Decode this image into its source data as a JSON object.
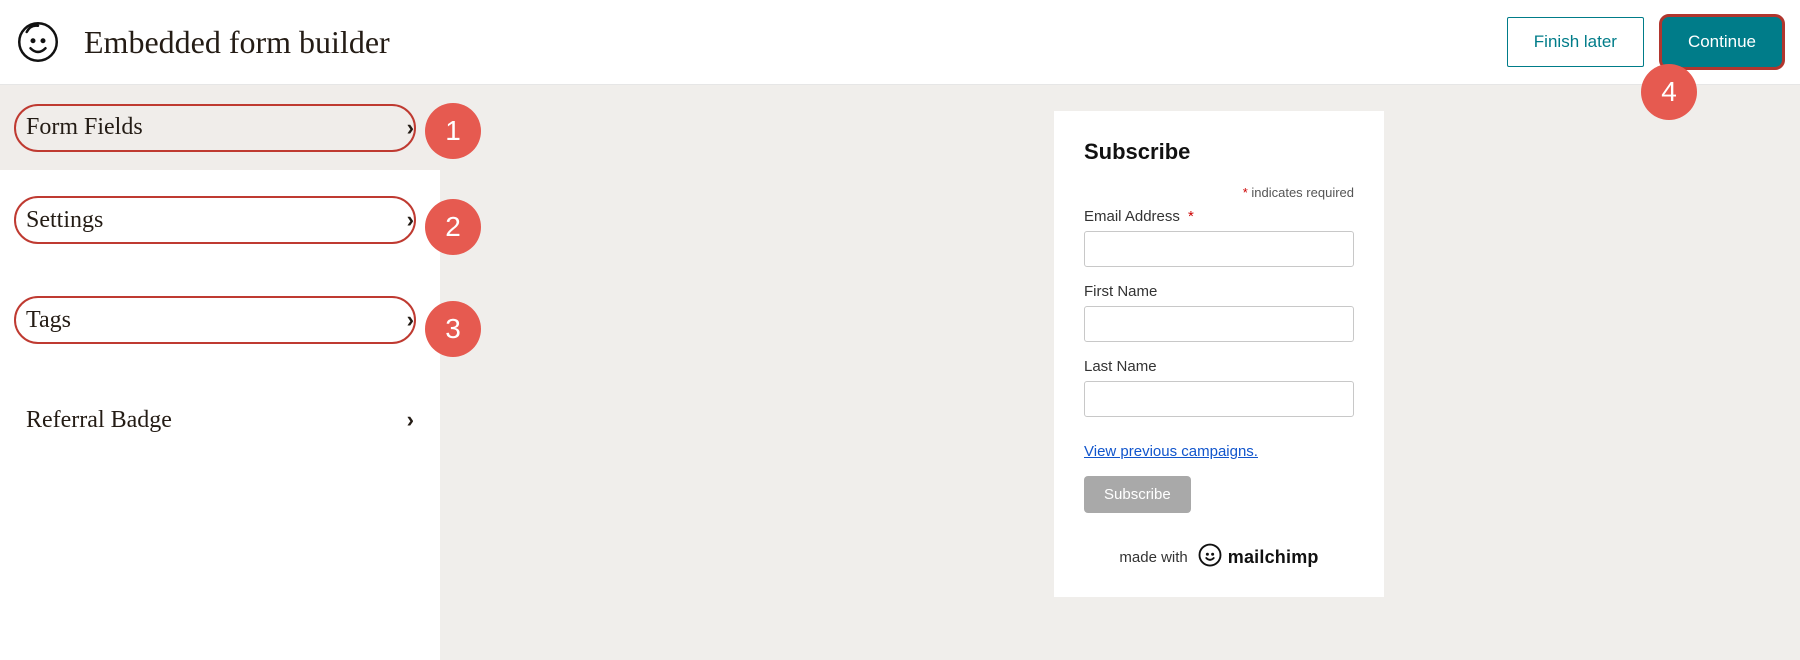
{
  "header": {
    "title": "Embedded form builder",
    "finish_later_label": "Finish later",
    "continue_label": "Continue"
  },
  "sidebar": {
    "items": [
      {
        "label": "Form Fields",
        "outlined": true,
        "active": true
      },
      {
        "label": "Settings",
        "outlined": true,
        "active": false
      },
      {
        "label": "Tags",
        "outlined": true,
        "active": false
      },
      {
        "label": "Referral Badge",
        "outlined": false,
        "active": false
      }
    ]
  },
  "callouts": {
    "1": "1",
    "2": "2",
    "3": "3",
    "4": "4"
  },
  "preview": {
    "title": "Subscribe",
    "required_note": "indicates required",
    "fields": {
      "email": {
        "label": "Email Address",
        "required": true,
        "value": ""
      },
      "first_name": {
        "label": "First Name",
        "required": false,
        "value": ""
      },
      "last_name": {
        "label": "Last Name",
        "required": false,
        "value": ""
      }
    },
    "previous_campaigns_link": "View previous campaigns.",
    "subscribe_label": "Subscribe",
    "made_with": "made with",
    "brand": "mailchimp"
  }
}
